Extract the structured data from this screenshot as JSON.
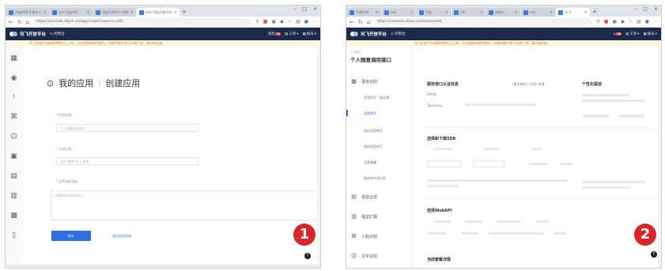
{
  "screenshot1": {
    "step_marker": "1",
    "tabs": [
      {
        "label": "百度SDK-文档中心"
      },
      {
        "label": "test-百度API"
      },
      {
        "label": "百度开放平台-控制台"
      },
      {
        "label": "test-百度开放平台"
      }
    ],
    "url": "https://console.xfyun.cn/app/create?source=info",
    "app_header": {
      "logo": "讯飞开放平台",
      "console_link": "控制台",
      "menu_notif_label": "消息",
      "notif_badge": "99",
      "menu_orders": "工单",
      "menu_account": "账号"
    },
    "notice": "讯飞开放平台新版控制台已上线，点击体验新版控制台，旧版控制台将于近期下线，请尽快迁移。",
    "page": {
      "title_left": "我的应用",
      "title_right": "创建应用",
      "field_name_label": "* 应用名称",
      "field_name_value": "个人随意调用接口",
      "field_category_label": "* 应用分类",
      "field_category_value": "应用-教育-学习-其他",
      "field_desc_label": "* 应用功能描述",
      "field_desc_value": "可随意测试各种接口",
      "submit": "提交",
      "back_link": "返回应用列表"
    },
    "help": "?"
  },
  "screenshot2": {
    "step_marker": "2",
    "tabs": [
      {
        "label": "百度SDK"
      },
      {
        "label": "test"
      },
      {
        "label": "百度"
      },
      {
        "label": "API"
      },
      {
        "label": "控制台"
      },
      {
        "label": "test"
      },
      {
        "label": "讯飞"
      }
    ],
    "url": "https://console.xfyun.cn/services/iat",
    "app_header": {
      "logo": "讯飞开放平台",
      "console_link": "控制台",
      "notif_badge": "99",
      "menu_orders": "工单",
      "menu_account": "账号"
    },
    "notice": "讯飞开放平台新版控制台已上线，点击体验新版控制台，旧版控制台将于近期下线，请尽快迁移。",
    "sidebar": {
      "back": "< 返回",
      "title": "个人随意调用接口",
      "group_voice": "语音识别",
      "sub_items": [
        "语音听写（流式版）",
        "语音转写",
        "实时语音转写",
        "离线语音听写",
        "语音唤醒",
        "离线命令词识别"
      ],
      "group_synthesis": "语音合成",
      "group_translate": "语音扩展",
      "group_face": "人脸识别",
      "group_text": "文字识别"
    },
    "main": {
      "sec_service": "服务接口认证信息",
      "service_tools": "[更多操作] [文档] 查看",
      "appid_label": "APPID",
      "appid_value": "5bxxxxxx",
      "apikey_label": "APIKey",
      "sec_sdk": "选择和下载SDK",
      "sec_webapi": "选择WebAPI",
      "sec_usage": "当前套餐详情",
      "personal_title": "个性化驱动"
    },
    "help": "?"
  }
}
